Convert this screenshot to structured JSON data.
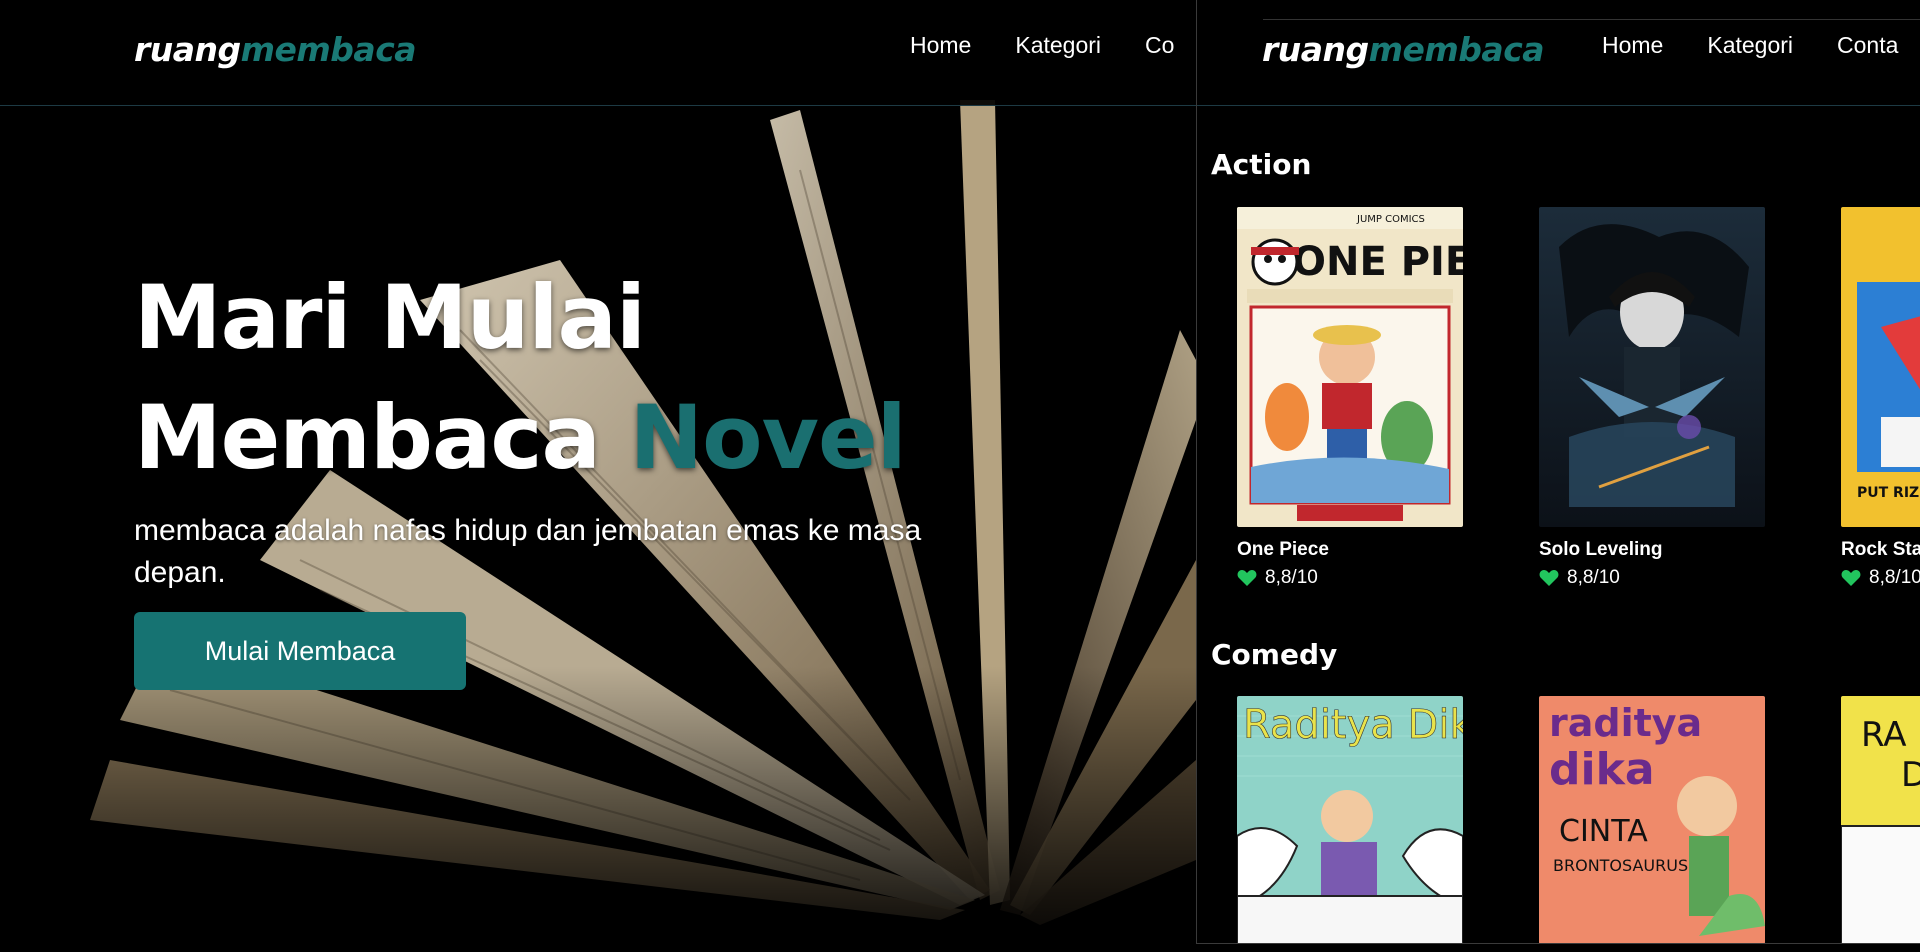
{
  "left": {
    "logo": {
      "part1": "ruang",
      "part2": "membaca"
    },
    "nav": [
      "Home",
      "Kategori",
      "Co"
    ],
    "hero": {
      "title_line1": "Mari Mulai",
      "title_line2": "Membaca",
      "title_accent": "Novel",
      "subtitle": "membaca adalah nafas hidup dan jembatan emas ke masa depan.",
      "button": "Mulai Membaca"
    }
  },
  "right": {
    "logo": {
      "part1": "ruang",
      "part2": "membaca"
    },
    "nav": [
      "Home",
      "Kategori",
      "Conta"
    ],
    "sections": [
      {
        "title": "Action",
        "books": [
          {
            "title": "One Piece",
            "rating": "8,8/10",
            "cover_text": "ONE PIECE"
          },
          {
            "title": "Solo Leveling",
            "rating": "8,8/10",
            "cover_text": ""
          },
          {
            "title": "Rock Star",
            "rating": "8,8/10",
            "cover_text": "PUT RIZKI"
          }
        ]
      },
      {
        "title": "Comedy",
        "books": [
          {
            "title": "",
            "rating": "",
            "cover_text": "Raditya Dika"
          },
          {
            "title": "",
            "rating": "",
            "cover_text": "raditya dika CINTA BRONTOSAURUS"
          },
          {
            "title": "",
            "rating": "",
            "cover_text": "RA D"
          }
        ]
      }
    ]
  },
  "colors": {
    "accent": "#1a7a76",
    "button": "#167372",
    "heart": "#22c55e"
  },
  "icons": {
    "rating": "heart-icon"
  }
}
